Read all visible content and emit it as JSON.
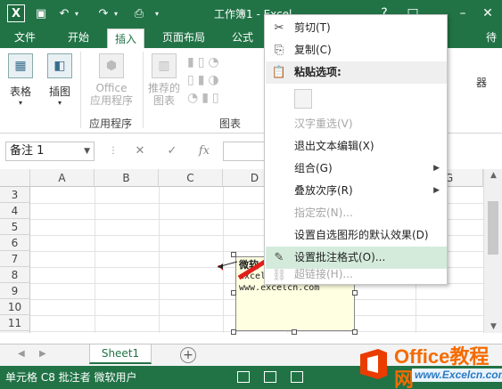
{
  "window": {
    "title": "工作簿1 - Excel",
    "help": "?",
    "restore": "□",
    "minimize": "–",
    "close": "✕"
  },
  "tabs": [
    "文件",
    "开始",
    "插入",
    "页面布局",
    "公式"
  ],
  "active_tab": "插入",
  "user": "待",
  "ribbon": {
    "buttons": [
      {
        "label": "表格",
        "icon": "table-icon"
      },
      {
        "label": "插图",
        "icon": "illustration-icon"
      },
      {
        "label": "Office\n应用程序",
        "icon": "office-apps-icon",
        "disabled": true
      },
      {
        "label": "推荐的\n图表",
        "icon": "recommended-chart-icon",
        "disabled": true
      }
    ],
    "groups": [
      "应用程序",
      "图表"
    ]
  },
  "formula_bar": {
    "name_box": "备注 1",
    "cancel": "✕",
    "enter": "✓",
    "fx": "fx"
  },
  "columns": [
    "A",
    "B",
    "C",
    "D",
    "E",
    "F",
    "G"
  ],
  "rows": [
    "3",
    "4",
    "5",
    "6",
    "7",
    "8",
    "9",
    "10",
    "11",
    "12"
  ],
  "comment": {
    "author": "微软",
    "line1": "excel",
    "line2": "www.excelcn.com"
  },
  "context_menu": {
    "items": [
      {
        "label": "剪切(T)",
        "icon": "scissors-icon",
        "state": "normal"
      },
      {
        "label": "复制(C)",
        "icon": "copy-icon",
        "state": "normal"
      },
      {
        "label": "粘贴选项:",
        "icon": "paste-icon",
        "state": "header"
      },
      {
        "label": "",
        "icon": "paste-clipboard-icon",
        "state": "paste-option"
      },
      {
        "label": "汉字重选(V)",
        "icon": "",
        "state": "disabled"
      },
      {
        "label": "退出文本编辑(X)",
        "icon": "",
        "state": "normal"
      },
      {
        "label": "组合(G)",
        "icon": "",
        "state": "submenu"
      },
      {
        "label": "叠放次序(R)",
        "icon": "",
        "state": "submenu"
      },
      {
        "label": "指定宏(N)...",
        "icon": "",
        "state": "disabled"
      },
      {
        "label": "设置自选图形的默认效果(D)",
        "icon": "",
        "state": "normal"
      },
      {
        "label": "设置批注格式(O)...",
        "icon": "format-comment-icon",
        "state": "highlight"
      },
      {
        "label": "超链接(H)...",
        "icon": "hyperlink-icon",
        "state": "disabled"
      }
    ]
  },
  "sheet": {
    "tab_name": "Sheet1",
    "add": "+"
  },
  "status": "单元格 C8 批注者 微软用户",
  "watermark": {
    "brand": "Office教程网",
    "site": "www.Excelcn.com"
  },
  "colors": {
    "excel_green": "#217346",
    "highlight": "#d4ebdc",
    "comment_bg": "#ffffe1",
    "arrow_red": "#e0201c"
  }
}
